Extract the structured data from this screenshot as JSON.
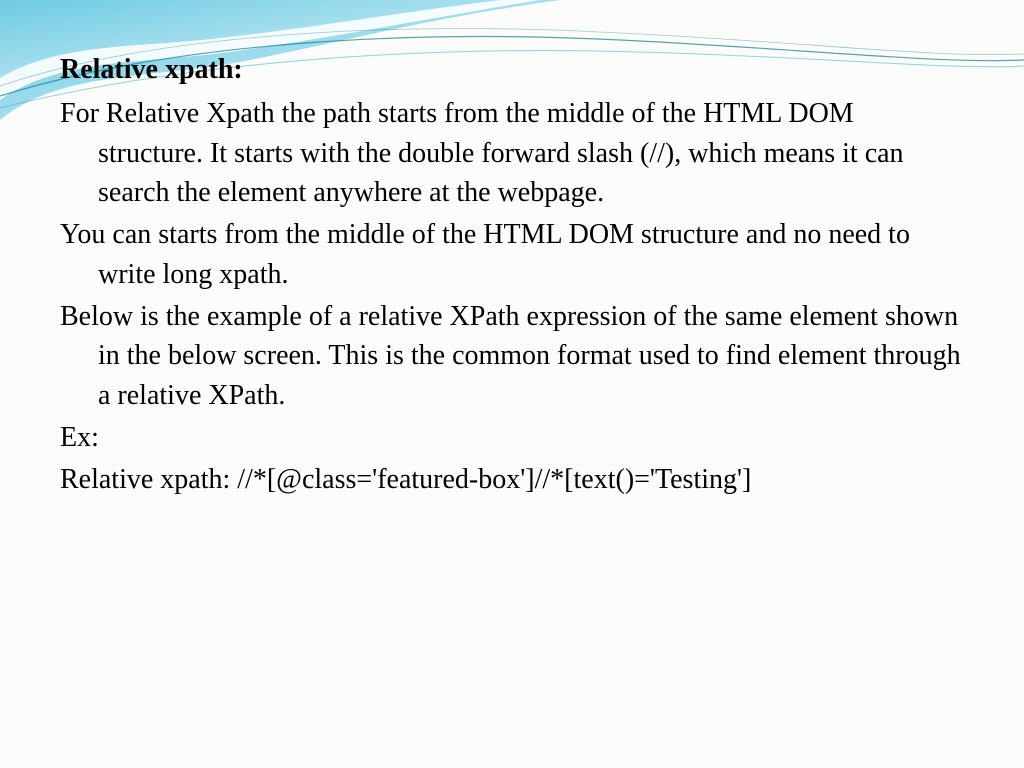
{
  "slide": {
    "title": "Relative xpath:",
    "paragraphs": [
      "For Relative Xpath the path starts from the middle of the HTML DOM structure. It starts with the double forward slash (//), which means it can search the element anywhere at the webpage.",
      "You can starts from the middle of the HTML DOM structure and no need to write long xpath.",
      "Below is the example of a relative XPath expression of the same element shown in the below screen. This is the common format used to find element through a relative XPath.",
      "Ex:",
      "Relative xpath: //*[@class='featured-box']//*[text()='Testing']"
    ]
  },
  "theme": {
    "accent_light": "#a9e0ef",
    "accent_mid": "#5fc6e0",
    "accent_dark": "#2aa8c9",
    "line_teal": "#0e7a8f"
  }
}
